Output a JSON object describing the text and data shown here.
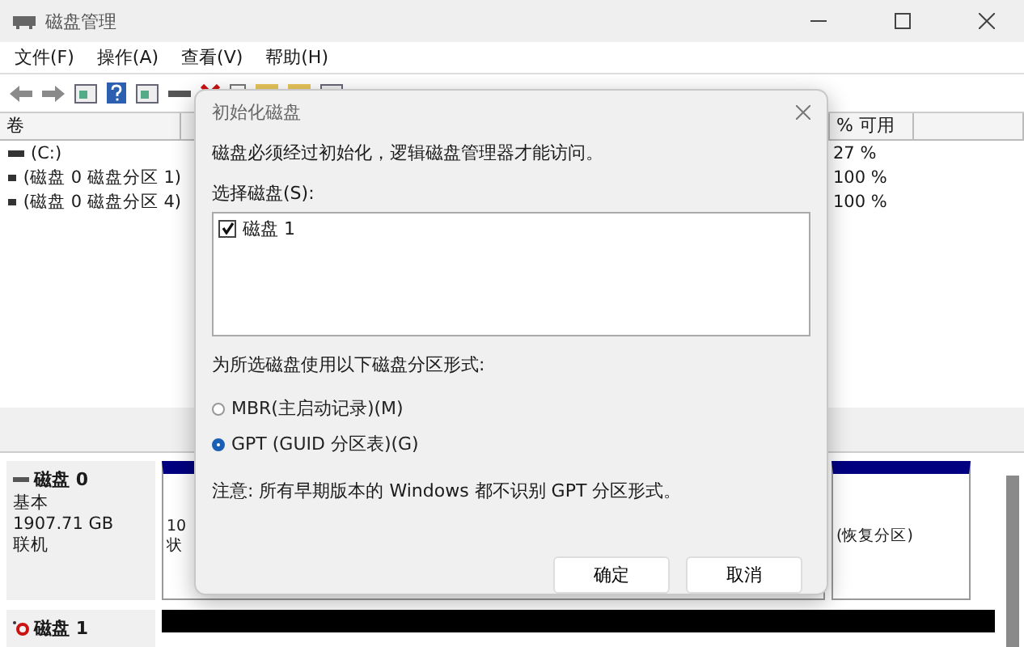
{
  "window": {
    "title": "磁盘管理"
  },
  "menu": [
    "文件(F)",
    "操作(A)",
    "查看(V)",
    "帮助(H)"
  ],
  "volumes": {
    "columns": [
      "卷",
      "% 可用"
    ],
    "rows": [
      {
        "volume": "(C:)",
        "free": "27 %"
      },
      {
        "volume": "(磁盘 0 磁盘分区 1)",
        "free": "100 %"
      },
      {
        "volume": "(磁盘 0 磁盘分区 4)",
        "free": "100 %"
      }
    ]
  },
  "disks": [
    {
      "kind": "basic",
      "name": "磁盘 0",
      "lines": [
        "基本",
        "1907.71 GB",
        "联机"
      ],
      "partitions": [
        {
          "lines": [
            "10",
            "状"
          ]
        },
        {
          "lines": [
            "(恢复分区)"
          ]
        }
      ]
    },
    {
      "kind": "uninitialized",
      "name": "磁盘 1"
    }
  ],
  "dialog": {
    "title": "初始化磁盘",
    "message": "磁盘必须经过初始化，逻辑磁盘管理器才能访问。",
    "list_label": "选择磁盘(S):",
    "disks": [
      {
        "label": "磁盘 1",
        "checked": true
      }
    ],
    "style_label": "为所选磁盘使用以下磁盘分区形式:",
    "options": [
      {
        "label": "MBR(主启动记录)(M)",
        "selected": false
      },
      {
        "label": "GPT (GUID 分区表)(G)",
        "selected": true
      }
    ],
    "note": "注意: 所有早期版本的 Windows 都不识别 GPT 分区形式。",
    "buttons": [
      "确定",
      "取消"
    ]
  }
}
